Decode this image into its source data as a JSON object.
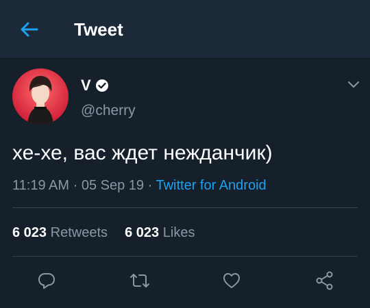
{
  "header": {
    "title": "Tweet",
    "back_icon": "arrow-left-icon"
  },
  "author": {
    "name": "V",
    "handle": "@cherry",
    "verified_icon": "verified-badge-icon"
  },
  "tweet": {
    "text": "хе-хе, вас ждет нежданчик)",
    "time": "11:19 AM",
    "date": "05 Sep 19",
    "separator": "·",
    "source": "Twitter for Android"
  },
  "stats": {
    "retweets_count": "6 023",
    "retweets_label": "Retweets",
    "likes_count": "6 023",
    "likes_label": "Likes"
  },
  "actions": [
    "reply-icon",
    "retweet-icon",
    "like-icon",
    "share-icon"
  ],
  "colors": {
    "background": "#15202b",
    "header": "#1c2938",
    "accent": "#1da1f2",
    "secondary_text": "#8899a6",
    "divider": "#38444d"
  }
}
